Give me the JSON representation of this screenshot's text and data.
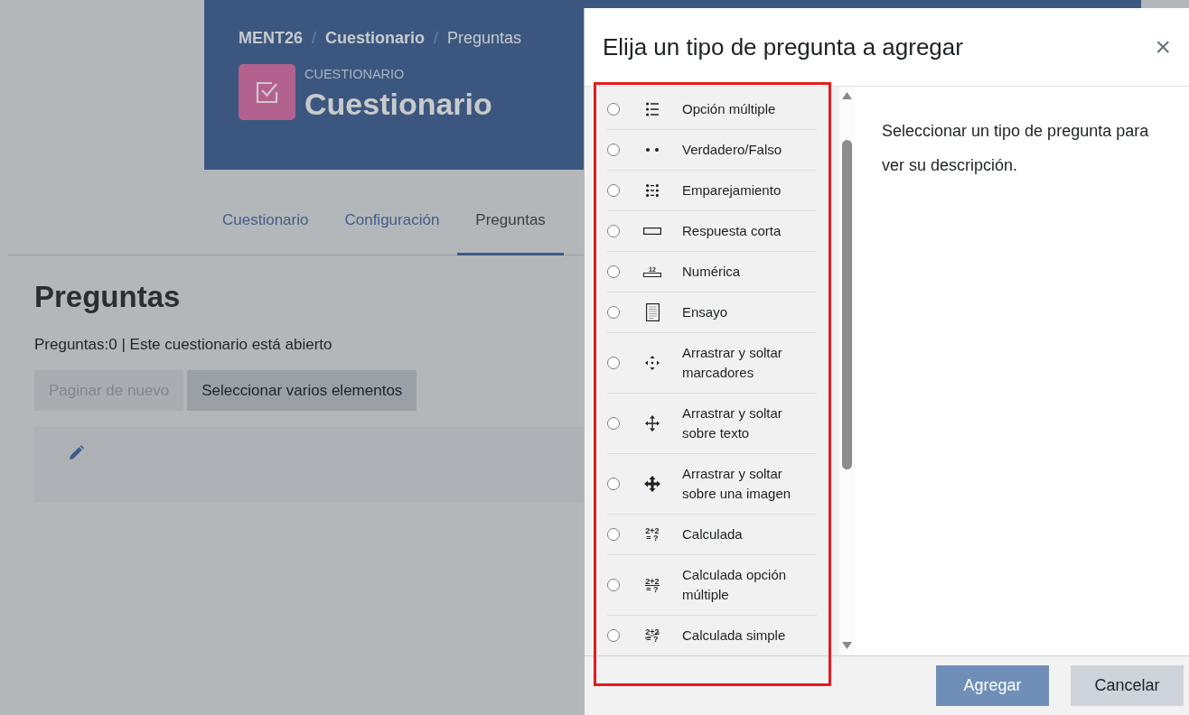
{
  "header": {
    "breadcrumb": {
      "separator": "/",
      "items": [
        {
          "label": "MENT26",
          "current": false
        },
        {
          "label": "Cuestionario",
          "current": false
        },
        {
          "label": "Preguntas",
          "current": true
        }
      ]
    },
    "module_type": "CUESTIONARIO",
    "title": "Cuestionario"
  },
  "tabs": [
    {
      "label": "Cuestionario",
      "selected": false
    },
    {
      "label": "Configuración",
      "selected": false
    },
    {
      "label": "Preguntas",
      "selected": true
    }
  ],
  "page": {
    "heading": "Preguntas",
    "status": "Preguntas:0 | Este cuestionario está abierto",
    "buttons": [
      {
        "label": "Paginar de nuevo",
        "disabled": true
      },
      {
        "label": "Seleccionar varios elementos",
        "disabled": false
      }
    ]
  },
  "modal": {
    "title": "Elija un tipo de pregunta a agregar",
    "close_label": "×",
    "question_types": [
      {
        "label": "Opción múltiple",
        "kind": "multichoice",
        "selected": false
      },
      {
        "label": "Verdadero/Falso",
        "kind": "truefalse",
        "selected": false
      },
      {
        "label": "Emparejamiento",
        "kind": "matching",
        "selected": false
      },
      {
        "label": "Respuesta corta",
        "kind": "shortanswer",
        "selected": false
      },
      {
        "label": "Numérica",
        "kind": "numerical",
        "selected": false,
        "icon_text": [
          "12"
        ]
      },
      {
        "label": "Ensayo",
        "kind": "essay",
        "selected": false
      },
      {
        "label": "Arrastrar y soltar marcadores",
        "kind": "markers",
        "selected": false
      },
      {
        "label": "Arrastrar y soltar sobre texto",
        "kind": "dragtext",
        "selected": false
      },
      {
        "label": "Arrastrar y soltar sobre una imagen",
        "kind": "dragimage",
        "selected": false
      },
      {
        "label": "Calculada",
        "kind": "calculated",
        "selected": false,
        "icon_text": [
          "2+2",
          "= ?"
        ]
      },
      {
        "label": "Calculada opción múltiple",
        "kind": "calculatedmulti",
        "selected": false,
        "icon_text": [
          "2+2",
          "= ?"
        ]
      },
      {
        "label": "Calculada simple",
        "kind": "calculatedsimple",
        "selected": false,
        "icon_text": [
          "2+2",
          "= ?"
        ]
      }
    ],
    "description": "Seleccionar un tipo de pregunta para ver su descripción.",
    "buttons": [
      {
        "label": "Agregar",
        "kind": "primary",
        "disabled": true
      },
      {
        "label": "Cancelar",
        "kind": "secondary",
        "disabled": false
      }
    ]
  }
}
